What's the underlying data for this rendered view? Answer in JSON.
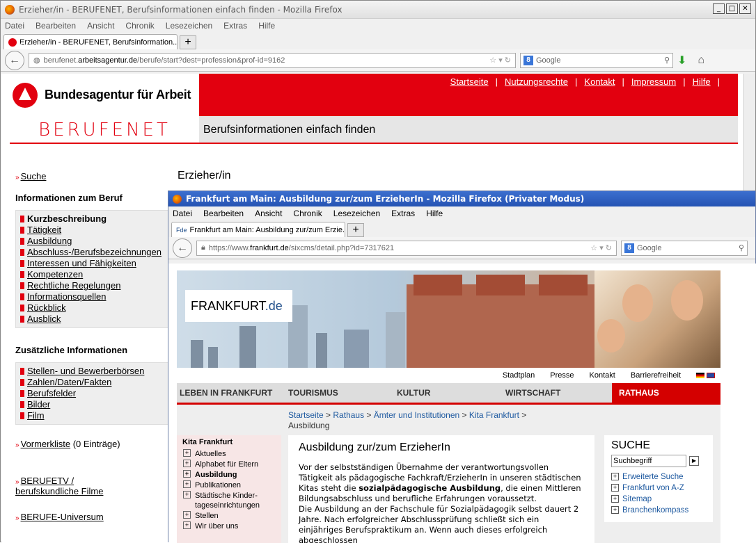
{
  "win1": {
    "title": "Erzieher/in - BERUFENET, Berufsinformationen einfach finden - Mozilla Firefox",
    "menu": [
      "Datei",
      "Bearbeiten",
      "Ansicht",
      "Chronik",
      "Lesezeichen",
      "Extras",
      "Hilfe"
    ],
    "tab_label": "Erzieher/in - BERUFENET, Berufsinformation...",
    "url": {
      "pre": "berufenet.",
      "domain": "arbeitsagentur.de",
      "post": "/berufe/start?dest=profession&prof-id=9162"
    },
    "search_placeholder": "Google"
  },
  "ba": {
    "logo_text": "Bundesagentur für Arbeit",
    "top_links": [
      "Startseite",
      "Nutzungsrechte",
      "Kontakt",
      "Impressum",
      "Hilfe"
    ],
    "brand": "BERUFENET",
    "tagline": "Berufsinformationen einfach finden",
    "page_title": "Erzieher/in",
    "search_link": "Suche",
    "info_heading": "Informationen zum Beruf",
    "info_items": [
      "Kurzbeschreibung",
      "Tätigkeit",
      "Ausbildung",
      "Abschluss-/Berufsbezeichnungen",
      "Interessen und Fähigkeiten",
      "Kompetenzen",
      "Rechtliche Regelungen",
      "Informationsquellen",
      "Rückblick",
      "Ausblick"
    ],
    "extra_heading": "Zusätzliche Informationen",
    "extra_items": [
      "Stellen- und Bewerberbörsen",
      "Zahlen/Daten/Fakten",
      "Berufsfelder",
      "Bilder",
      "Film"
    ],
    "vormerk_link": "Vormerkliste",
    "vormerk_count": "(0 Einträge)",
    "berufetv_1": "BERUFETV /",
    "berufetv_2": "berufskundliche Filme",
    "universum": "BERUFE-Universum"
  },
  "win2": {
    "title": "Frankfurt am Main: Ausbildung zur/zum ErzieherIn - Mozilla Firefox (Privater Modus)",
    "menu": [
      "Datei",
      "Bearbeiten",
      "Ansicht",
      "Chronik",
      "Lesezeichen",
      "Extras",
      "Hilfe"
    ],
    "tab_label": "Frankfurt am Main: Ausbildung zur/zum Erzie...",
    "url": {
      "pre": "https://www.",
      "domain": "frankfurt.de",
      "post": "/sixcms/detail.php?id=7317621"
    },
    "search_placeholder": "Google"
  },
  "ffm": {
    "logo_main": "FRANKFURT",
    "logo_tld": ".de",
    "utility": [
      "Stadtplan",
      "Presse",
      "Kontakt",
      "Barrierefreiheit"
    ],
    "nav": [
      "LEBEN IN FRANKFURT",
      "TOURISMUS",
      "KULTUR",
      "WIRTSCHAFT",
      "RATHAUS"
    ],
    "crumbs": [
      "Startseite",
      "Rathaus",
      "Ämter und Institutionen",
      "Kita Frankfurt"
    ],
    "crumb_current": "Ausbildung",
    "side_heading": "Kita Frankfurt",
    "side_items": [
      "Aktuelles",
      "Alphabet für Eltern",
      "Ausbildung",
      "Publikationen",
      "Städtische Kinder-tageseinrichtungen",
      "Stellen",
      "Wir über uns"
    ],
    "article_title": "Ausbildung zur/zum ErzieherIn",
    "article_p1a": "Vor der selbstständigen Übernahme der verantwortungsvollen Tätigkeit als pädagogische Fachkraft/ErzieherIn in unseren städtischen Kitas steht die ",
    "article_p1b": "sozialpädagogische Ausbildung",
    "article_p1c": ", die einen Mittleren Bildungsabschluss und berufliche Erfahrungen voraussetzt.",
    "article_p2": "Die Ausbildung an der Fachschule für Sozialpädagogik selbst dauert 2 Jahre. Nach erfolgreicher Abschlussprüfung schließt sich ein einjähriges Berufspraktikum an. Wenn auch dieses erfolgreich abgeschlossen",
    "search_heading": "SUCHE",
    "search_placeholder": "Suchbegriff",
    "search_links": [
      "Erweiterte Suche",
      "Frankfurt von A-Z",
      "Sitemap",
      "Branchenkompass"
    ]
  }
}
